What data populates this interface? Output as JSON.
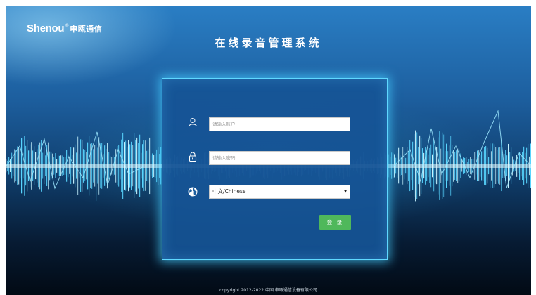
{
  "header": {
    "logo_en": "Shenou",
    "logo_reg": "®",
    "logo_cn": "申瓯通信",
    "title": "在线录音管理系统"
  },
  "login": {
    "account_placeholder": "请输入账户",
    "password_placeholder": "请输入密码",
    "language_selected": "中文/Chinese",
    "submit_label": "登 录"
  },
  "icons": {
    "account": "user-icon",
    "password": "lock-icon",
    "language": "globe-icon",
    "dropdown": "caret-down-icon"
  },
  "footer": {
    "copyright": "copyright 2012-2022 中国 申瓯通信设备有限公司"
  },
  "colors": {
    "accent_button": "#4fb85b",
    "panel_glow": "#5fd8ff"
  }
}
